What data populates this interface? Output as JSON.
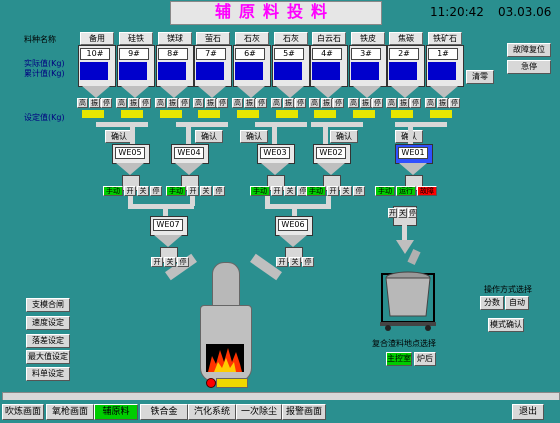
{
  "header": {
    "title": "辅原料投料",
    "time": "11:20:42",
    "date": "03.03.06"
  },
  "left_labels": {
    "material_name": "料种名称",
    "actual": "实际值(Kg)",
    "cumulative": "累计值(Kg)",
    "setpoint": "设定值(Kg)"
  },
  "bins": [
    {
      "name": "备用",
      "num": "10#"
    },
    {
      "name": "硅铁",
      "num": "9#"
    },
    {
      "name": "镁球",
      "num": "8#"
    },
    {
      "name": "萤石",
      "num": "7#"
    },
    {
      "name": "石灰",
      "num": "6#"
    },
    {
      "name": "石灰",
      "num": "5#"
    },
    {
      "name": "白云石",
      "num": "4#"
    },
    {
      "name": "铁皮",
      "num": "3#"
    },
    {
      "name": "焦碳",
      "num": "2#"
    },
    {
      "name": "铁矿石",
      "num": "1#"
    }
  ],
  "bin_buttons": [
    "高",
    "振",
    "停"
  ],
  "confirm": "确认",
  "weighers": [
    "WE05",
    "WE04",
    "WE03",
    "WE02",
    "WE01",
    "WE07",
    "WE06"
  ],
  "mode": {
    "manual": "手动",
    "running": "运行",
    "open": "开",
    "close": "关",
    "stop": "停",
    "fault": "故障"
  },
  "right_panel": {
    "fault_reset": "故障复位",
    "emergency_stop": "急停",
    "clear_zero": "清零",
    "op_mode_title": "操作方式选择",
    "sub": "分数",
    "auto": "自动",
    "mode_confirm": "模式确认"
  },
  "ladle": {
    "label": "复合渣料地点选择",
    "main_btn": "主控室",
    "furnace_btn": "炉后"
  },
  "left_buttons": [
    "支模合闸",
    "速度设定",
    "落差设定",
    "最大值设定",
    "料单设定"
  ],
  "tabs": [
    "吹炼画面",
    "氧枪画面",
    "辅原料",
    "铁合金",
    "汽化系统",
    "一次除尘",
    "报警画面"
  ],
  "exit": "退出"
}
